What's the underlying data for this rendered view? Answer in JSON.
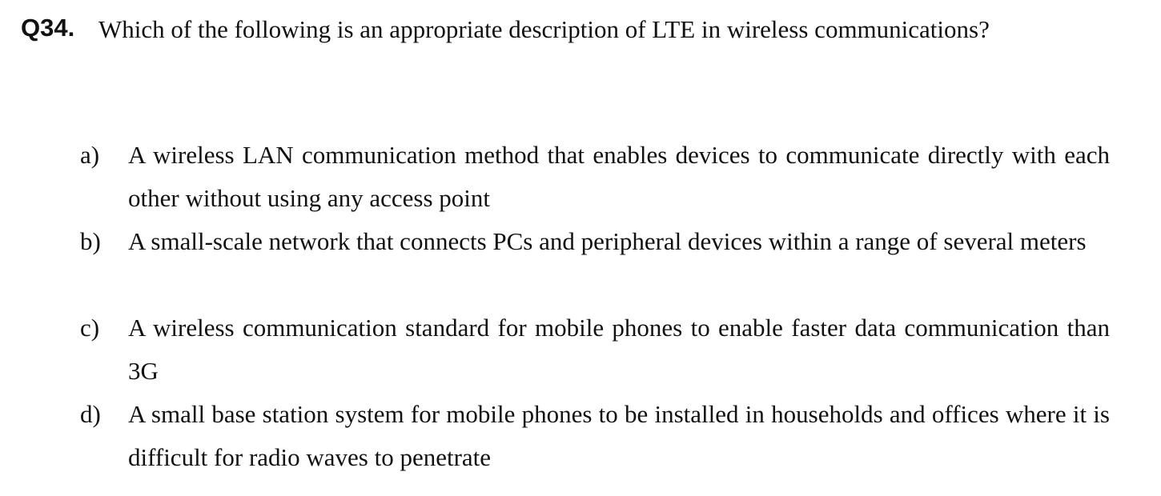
{
  "question": {
    "number": "Q34.",
    "text": "Which of the following is an appropriate description of LTE in wireless communications?"
  },
  "options": [
    {
      "letter": "a)",
      "text": "A wireless LAN communication method that enables devices to communicate directly with each other without using any access point"
    },
    {
      "letter": "b)",
      "text": "A small-scale network that connects PCs and peripheral devices within a range of several meters"
    },
    {
      "letter": "c)",
      "text": "A wireless communication standard for mobile phones to enable faster data communication than 3G"
    },
    {
      "letter": "d)",
      "text": "A small base station system for mobile phones to be installed in households and offices where it is difficult for radio waves to penetrate"
    }
  ]
}
